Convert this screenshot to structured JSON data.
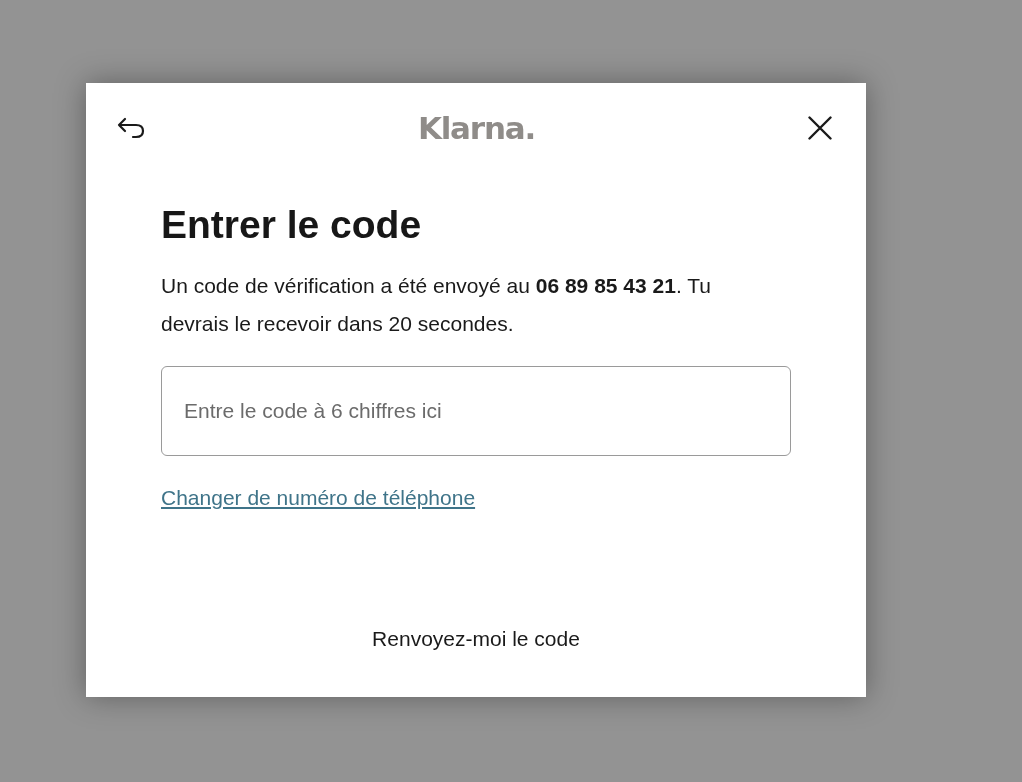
{
  "dialog": {
    "logo": "Klarna.",
    "title": "Entrer le code",
    "message": "Un code de vérification a été envoyé au **06 89 85 43 21**. Tu devrais le recevoir dans 20 secondes.",
    "code_field": {
      "placeholder": "Entre le code à 6 chiffres ici"
    },
    "change_number_link": "Changer de numéro de téléphone",
    "resend_button": "Renvoyez-moi le code"
  }
}
